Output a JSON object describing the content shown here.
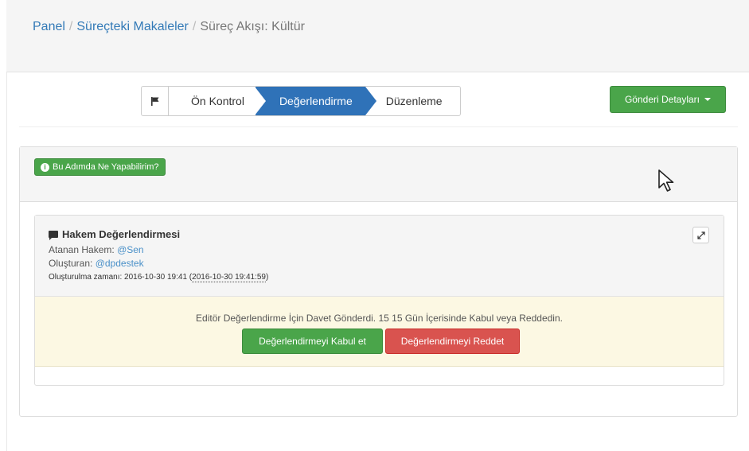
{
  "breadcrumb": {
    "items": [
      "Panel",
      "Süreçteki Makaleler"
    ],
    "separator": "/",
    "current": "Süreç Akışı: Kültür"
  },
  "steps": {
    "items": [
      "Ön Kontrol",
      "Değerlendirme",
      "Düzenleme"
    ],
    "active_index": 1
  },
  "details_button": {
    "label": "Gönderi Detayları"
  },
  "help_button": {
    "label": "Bu Adımda Ne Yapabilirim?"
  },
  "review": {
    "title": "Hakem Değerlendirmesi",
    "assigned_label": "Atanan Hakem:",
    "assigned_value": "@Sen",
    "creator_label": "Oluşturan:",
    "creator_value": "@dpdestek",
    "created_label": "Oluşturulma zamanı:",
    "created_value": "2016-10-30 19:41",
    "created_exact": "2016-10-30 19:41:59"
  },
  "invite": {
    "message": "Editör Değerlendirme İçin Davet Gönderdi. 15 15 Gün İçerisinde Kabul veya Reddedin.",
    "accept_label": "Değerlendirmeyi Kabul et",
    "reject_label": "Değerlendirmeyi Reddet"
  },
  "colors": {
    "primary": "#2f72b8",
    "success": "#4aa54a",
    "danger": "#d9534f",
    "warning_bg": "#fcf8e3"
  }
}
